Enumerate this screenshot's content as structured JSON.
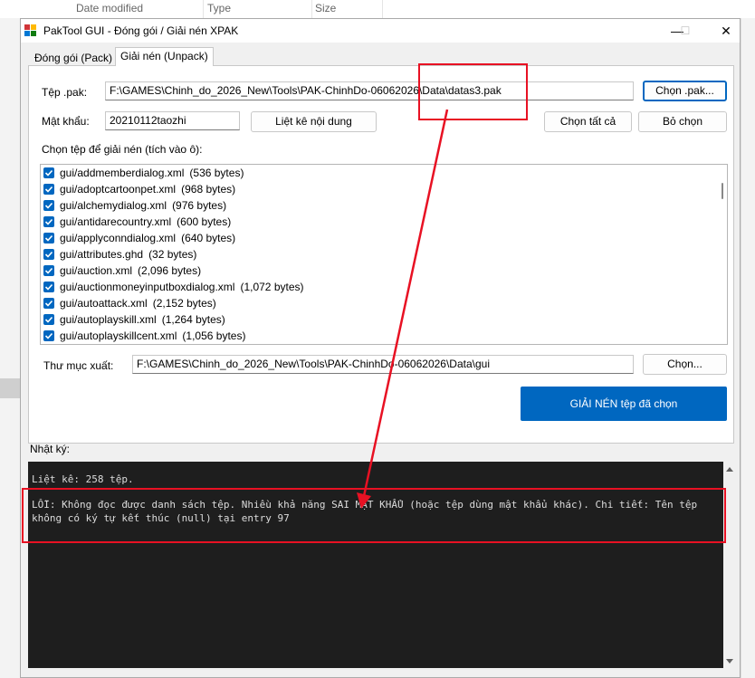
{
  "background": {
    "columns": [
      "Date modified",
      "Type",
      "Size"
    ]
  },
  "window": {
    "title": "PakTool GUI - Đóng gói / Giải nén XPAK",
    "minimize": "—",
    "maximize": "☐",
    "close": "✕"
  },
  "tabs": [
    {
      "label": "Đóng gói (Pack)",
      "active": false
    },
    {
      "label": "Giải nén (Unpack)",
      "active": true
    }
  ],
  "unpack": {
    "pak_label": "Tệp .pak:",
    "pak_value": "F:\\GAMES\\Chinh_do_2026_New\\Tools\\PAK-ChinhDo-06062026\\Data\\datas3.pak",
    "choose_pak_button": "Chọn .pak...",
    "password_label": "Mật khẩu:",
    "password_value": "20210112taozhi",
    "list_button": "Liệt kê nội dung",
    "select_all_button": "Chọn tất cả",
    "deselect_button": "Bỏ chọn",
    "files_label": "Chọn tệp để giải nén (tích vào ô):",
    "files": [
      {
        "name": "gui/addmemberdialog.xml",
        "size": "(536 bytes)"
      },
      {
        "name": "gui/adoptcartoonpet.xml",
        "size": "(968 bytes)"
      },
      {
        "name": "gui/alchemydialog.xml",
        "size": "(976 bytes)"
      },
      {
        "name": "gui/antidarecountry.xml",
        "size": "(600 bytes)"
      },
      {
        "name": "gui/applyconndialog.xml",
        "size": "(640 bytes)"
      },
      {
        "name": "gui/attributes.ghd",
        "size": "(32 bytes)"
      },
      {
        "name": "gui/auction.xml",
        "size": "(2,096 bytes)"
      },
      {
        "name": "gui/auctionmoneyinputboxdialog.xml",
        "size": "(1,072 bytes)"
      },
      {
        "name": "gui/autoattack.xml",
        "size": "(2,152 bytes)"
      },
      {
        "name": "gui/autoplayskill.xml",
        "size": "(1,264 bytes)"
      },
      {
        "name": "gui/autoplayskillcent.xml",
        "size": "(1,056 bytes)"
      }
    ],
    "output_label": "Thư mục xuất:",
    "output_value": "F:\\GAMES\\Chinh_do_2026_New\\Tools\\PAK-ChinhDo-06062026\\Data\\gui",
    "choose_output_button": "Chọn...",
    "extract_button": "GIẢI NÉN tệp đã chọn"
  },
  "log": {
    "label": "Nhật ký:",
    "lines": [
      "Liệt kê: 258 tệp.",
      "LỖI: Không đọc được danh sách tệp. Nhiều khả năng SAI MẬT KHẨU (hoặc tệp dùng mật khẩu khác). Chi tiết: Tên tệp không có ký tự kết thúc (null) tại entry 97"
    ]
  },
  "colors": {
    "accent": "#0067c0",
    "annotation": "#e81123",
    "log_bg": "#1e1e1e"
  }
}
